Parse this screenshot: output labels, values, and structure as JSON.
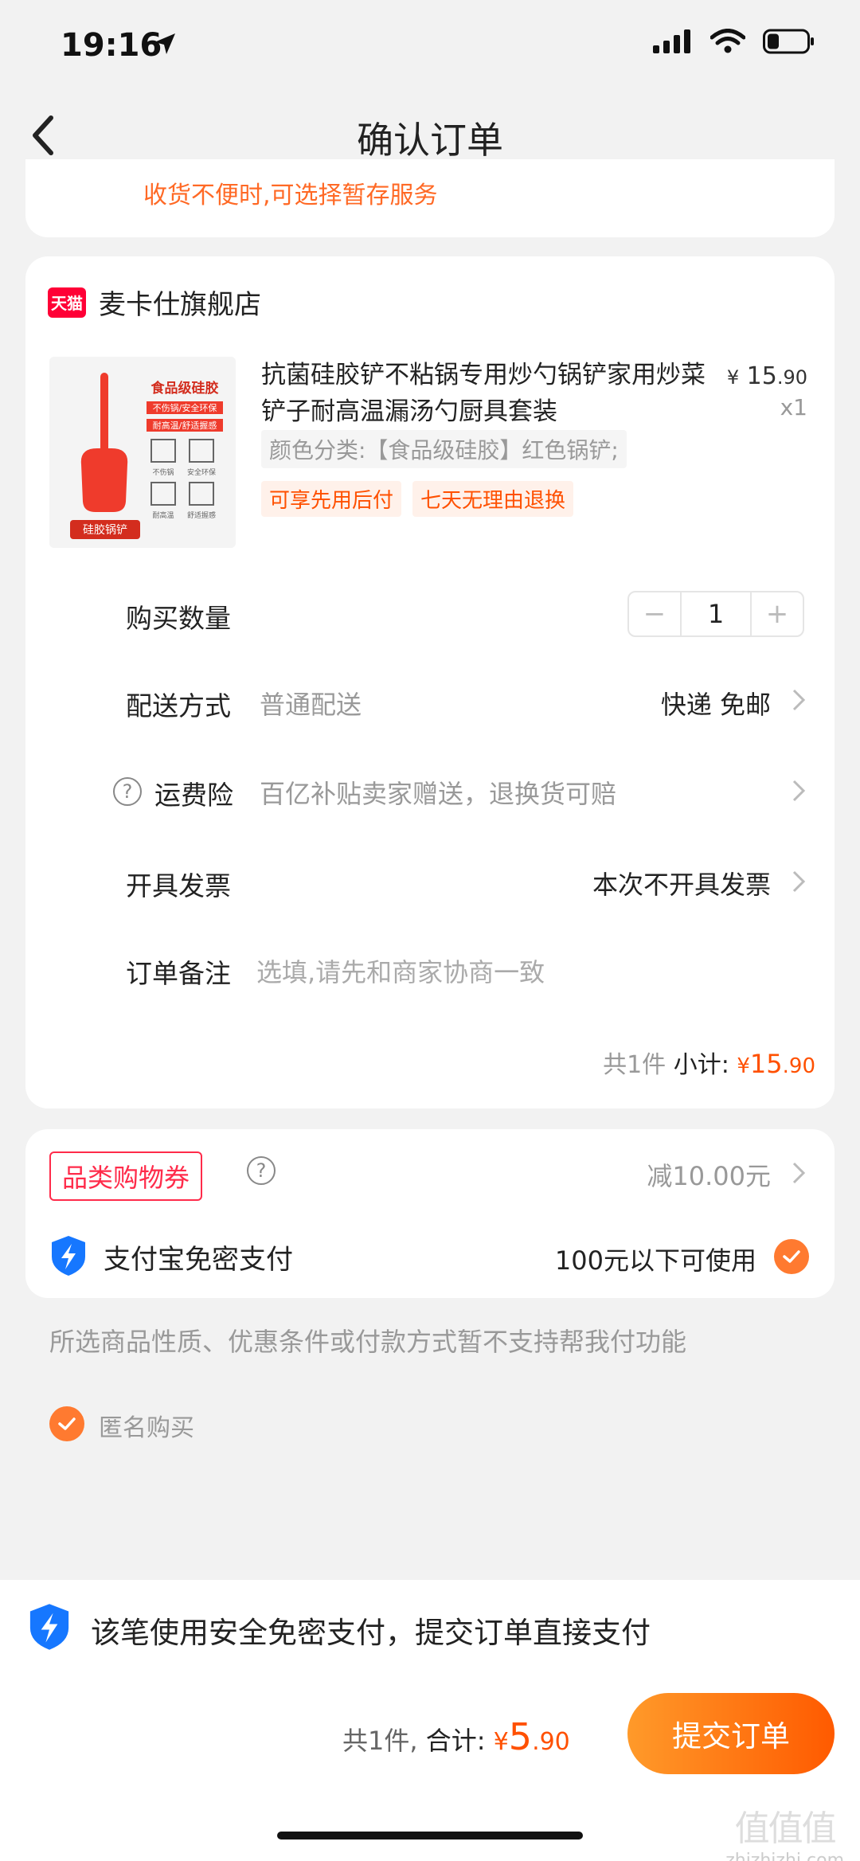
{
  "status_bar": {
    "time": "19:16"
  },
  "nav": {
    "title": "确认订单"
  },
  "top_hint": "收货不便时,可选择暂存服务",
  "store": {
    "logo_text": "天猫",
    "name": "麦卡仕旗舰店"
  },
  "product": {
    "title": "抗菌硅胶铲不粘锅专用炒勺锅铲家用炒菜铲子耐高温漏汤勺厨具套装",
    "price_symbol": "¥",
    "price_int": "15",
    "price_dec": ".90",
    "qty": "x1",
    "spec": "颜色分类:【食品级硅胶】红色锅铲;",
    "tags": [
      "可享先用后付",
      "七天无理由退换"
    ],
    "image_texts": {
      "title": "食品级硅胶",
      "line1": "不伤锅/安全环保",
      "line2": "耐高温/舒适握感",
      "caption": "硅胶锅铲",
      "f1": "不伤锅",
      "f2": "安全环保",
      "f3": "耐高温",
      "f4": "舒适握感"
    }
  },
  "rows": {
    "quantity": {
      "label": "购买数量",
      "minus": "−",
      "value": "1",
      "plus": "+"
    },
    "delivery": {
      "label": "配送方式",
      "value": "普通配送",
      "right": "快递 免邮"
    },
    "insurance": {
      "label": "运费险",
      "value": "百亿补贴卖家赠送，退换货可赔"
    },
    "invoice": {
      "label": "开具发票",
      "right": "本次不开具发票"
    },
    "note": {
      "label": "订单备注",
      "placeholder": "选填,请先和商家协商一致"
    }
  },
  "subtotal": {
    "count": "共1件",
    "label": "小计:",
    "symbol": "¥",
    "int": "15",
    "dec": ".90"
  },
  "coupon": {
    "label": "品类购物券",
    "value": "减10.00元"
  },
  "alipay": {
    "label": "支付宝免密支付",
    "right": "100元以下可使用"
  },
  "notice": "所选商品性质、优惠条件或付款方式暂不支持帮我付功能",
  "anonymous": "匿名购买",
  "bottom": {
    "secure_text": "该笔使用安全免密支付，提交订单直接支付",
    "count": "共1件,",
    "total_label": "合计:",
    "symbol": "¥",
    "int": "5",
    "dec": ".90",
    "submit": "提交订单"
  },
  "watermark": {
    "logo": "值值值",
    "url": "zhizhizhi.com"
  },
  "colors": {
    "accent": "#ff5000",
    "tmall": "#ff0036",
    "alipay": "#1677ff"
  }
}
